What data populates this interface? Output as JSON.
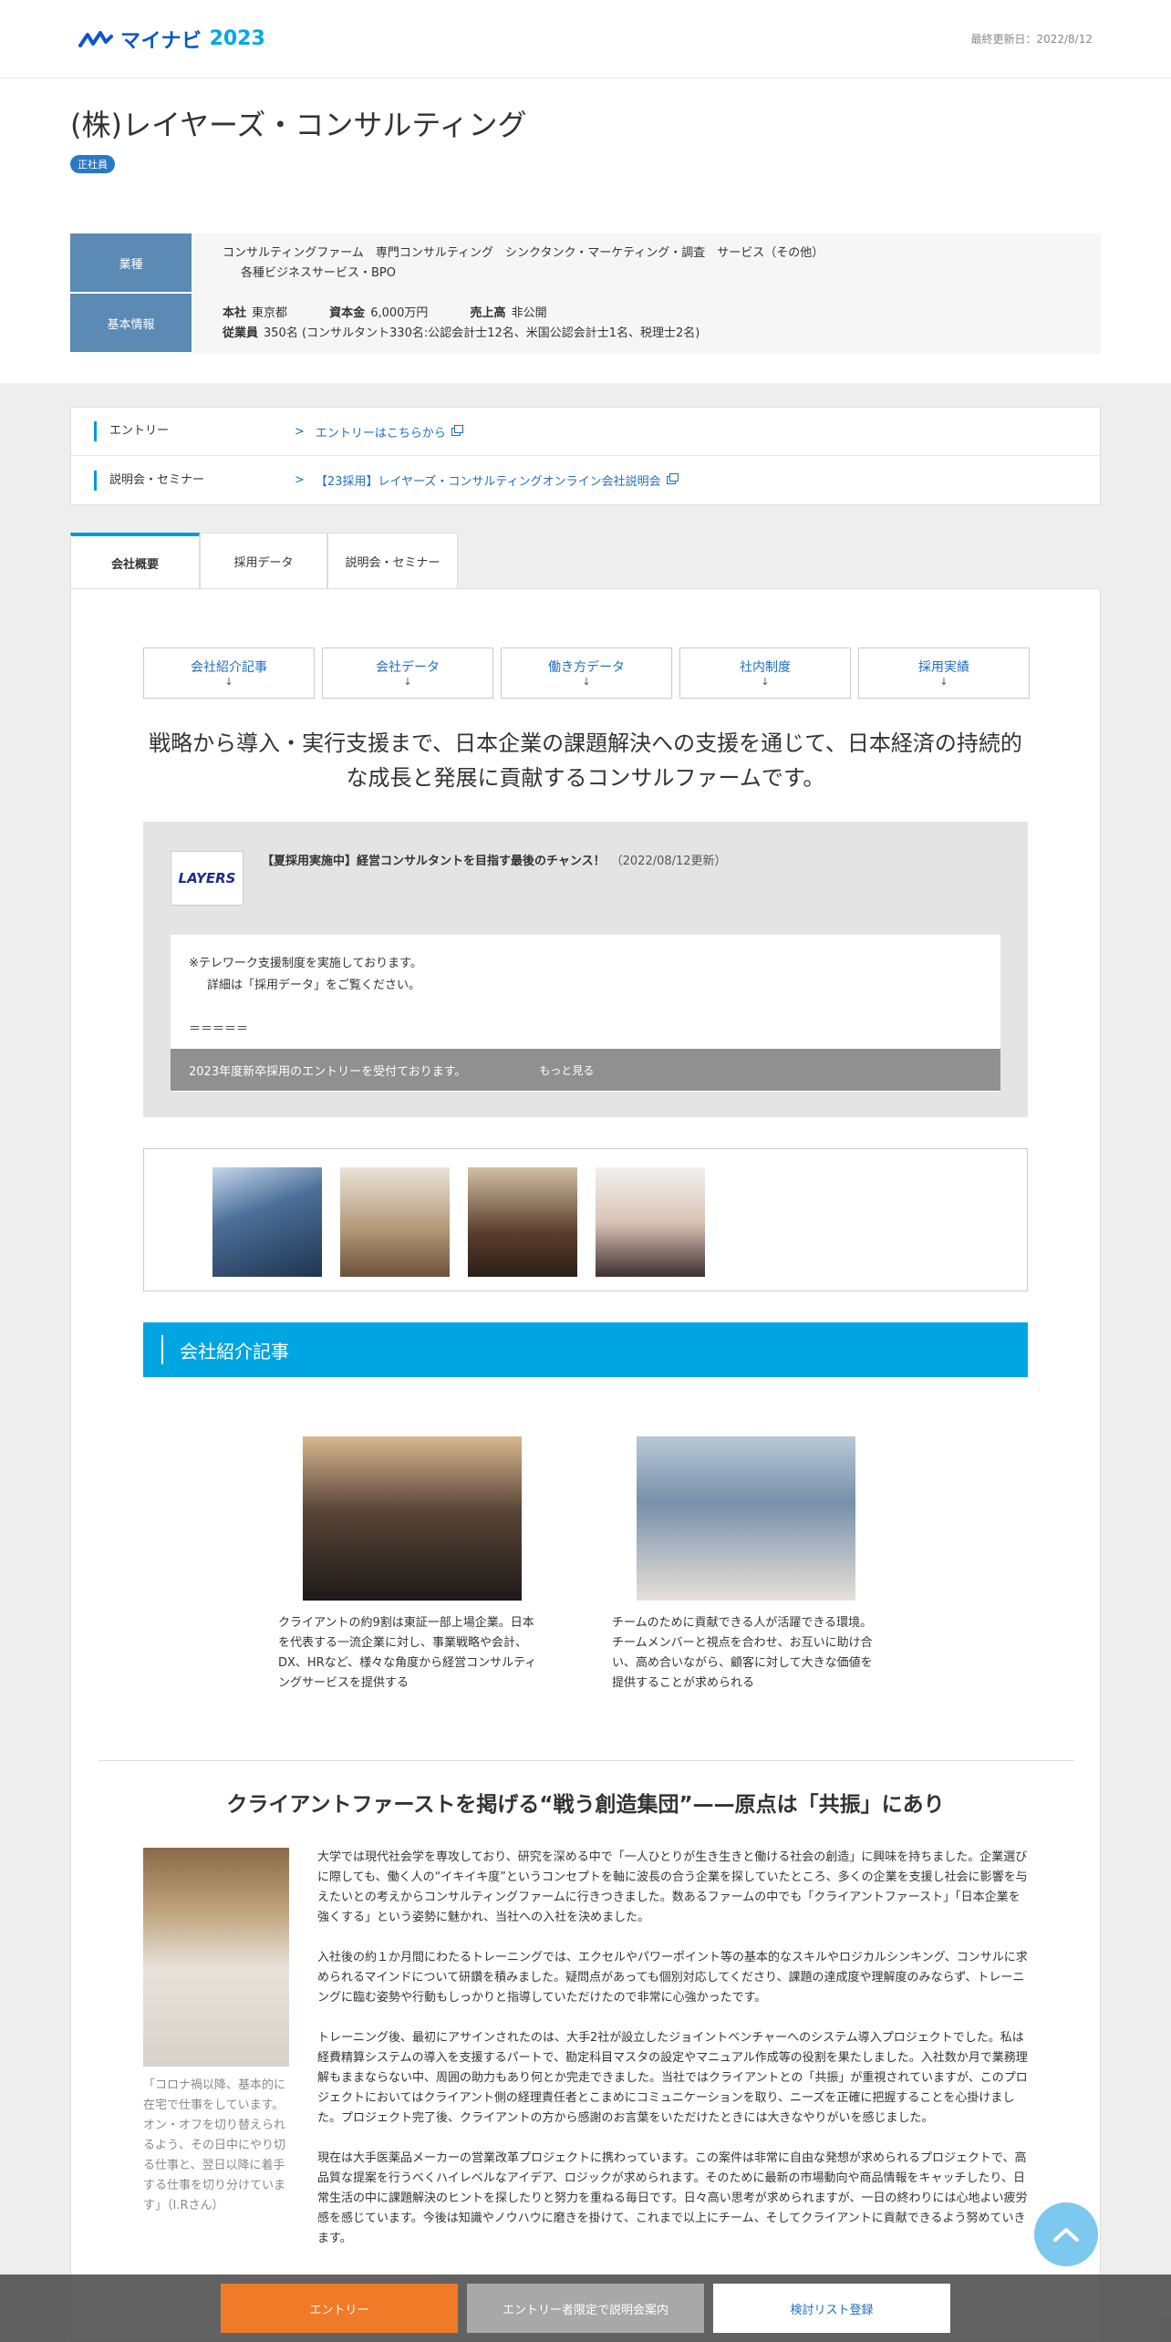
{
  "header": {
    "logo_text": "マイナビ",
    "logo_year": "2023",
    "updated": "最終更新日：2022/8/12"
  },
  "company": {
    "name": "(株)レイヤーズ・コンサルティング",
    "badge": "正社員"
  },
  "info": {
    "industry_label": "業種",
    "industry_line1": "コンサルティングファーム　専門コンサルティング　シンクタンク・マーケティング・調査　サービス（その他）",
    "industry_line2": "各種ビジネスサービス・BPO",
    "basic_label": "基本情報",
    "hq_label": "本社",
    "hq_value": "東京都",
    "capital_label": "資本金",
    "capital_value": "6,000万円",
    "sales_label": "売上高",
    "sales_value": "非公開",
    "employees_label": "従業員",
    "employees_value": "350名 (コンサルタント330名:公認会計士12名、米国公認会計士1名、税理士2名)"
  },
  "links": {
    "entry_label": "エントリー",
    "entry_value": "エントリーはこちらから",
    "seminar_label": "説明会・セミナー",
    "seminar_value": "【23採用】レイヤーズ・コンサルティングオンライン会社説明会"
  },
  "tabs": [
    "会社概要",
    "採用データ",
    "説明会・セミナー"
  ],
  "subnav": [
    "会社紹介記事",
    "会社データ",
    "働き方データ",
    "社内制度",
    "採用実績"
  ],
  "subnav_arrow": "↓",
  "catch_copy": "戦略から導入・実行支援まで、日本企業の課題解決への支援を通じて、日本経済の持続的な成長と発展に貢献するコンサルファームです。",
  "notice": {
    "logo_text": "LAYERS",
    "title": "【夏採用実施中】経営コンサルタントを目指す最後のチャンス！",
    "date": "（2022/08/12更新）",
    "line1": "※テレワーク支援制度を実施しております。",
    "line2": "詳細は「採用データ」をご覧ください。",
    "line3": "＝＝＝＝＝",
    "foot": "2023年度新卒採用のエントリーを受付ております。",
    "more": "もっと見る"
  },
  "section_title": "会社紹介記事",
  "articles": [
    "クライアントの約9割は東証一部上場企業。日本を代表する一流企業に対し、事業戦略や会計、DX、HRなど、様々な角度から経営コンサルティングサービスを提供する",
    "チームのために貢献できる人が活躍できる環境。チームメンバーと視点を合わせ、お互いに助け合い、高め合いながら、顧客に対して大きな価値を提供することが求められる"
  ],
  "interview": {
    "title": "クライアントファーストを掲げる“戦う創造集団”——原点は「共振」にあり",
    "caption": "「コロナ禍以降、基本的に在宅で仕事をしています。オン・オフを切り替えられるよう、その日中にやり切る仕事と、翌日以降に着手する仕事を切り分けています」（I.Rさん）",
    "paragraphs": [
      "大学では現代社会学を専攻しており、研究を深める中で「一人ひとりが生き生きと働ける社会の創造」に興味を持ちました。企業選びに際しても、働く人の“イキイキ度”というコンセプトを軸に波長の合う企業を探していたところ、多くの企業を支援し社会に影響を与えたいとの考えからコンサルティングファームに行きつきました。数あるファームの中でも「クライアントファースト」「日本企業を強くする」という姿勢に魅かれ、当社への入社を決めました。",
      "入社後の約１か月間にわたるトレーニングでは、エクセルやパワーポイント等の基本的なスキルやロジカルシンキング、コンサルに求められるマインドについて研鑽を積みました。疑問点があっても個別対応してくださり、課題の達成度や理解度のみならず、トレーニングに臨む姿勢や行動もしっかりと指導していただけたので非常に心強かったです。",
      "トレーニング後、最初にアサインされたのは、大手2社が設立したジョイントベンチャーへのシステム導入プロジェクトでした。私は経費精算システムの導入を支援するパートで、勘定科目マスタの設定やマニュアル作成等の役割を果たしました。入社数か月で業務理解もままならない中、周囲の助力もあり何とか完走できました。当社ではクライアントとの「共振」が重視されていますが、このプロジェクトにおいてはクライアント側の経理責任者とこまめにコミュニケーションを取り、ニーズを正確に把握することを心掛けました。プロジェクト完了後、クライアントの方から感謝のお言葉をいただけたときには大きなやりがいを感じました。",
      "現在は大手医薬品メーカーの営業改革プロジェクトに携わっています。この案件は非常に自由な発想が求められるプロジェクトで、高品質な提案を行うべくハイレベルなアイデア、ロジックが求められます。そのために最新の市場動向や商品情報をキャッチしたり、日常生活の中に課題解決のヒントを探したりと努力を重ねる毎日です。日々高い思考が求められますが、一日の終わりには心地よい疲労感を感じています。今後は知識やノウハウに磨きを掛けて、これまで以上にチーム、そしてクライアントに貢献できるよう努めていきます。"
    ]
  },
  "footer": {
    "entry": "エントリー",
    "limited": "エントリー者限定で説明会案内",
    "list": "検討リスト登録"
  }
}
